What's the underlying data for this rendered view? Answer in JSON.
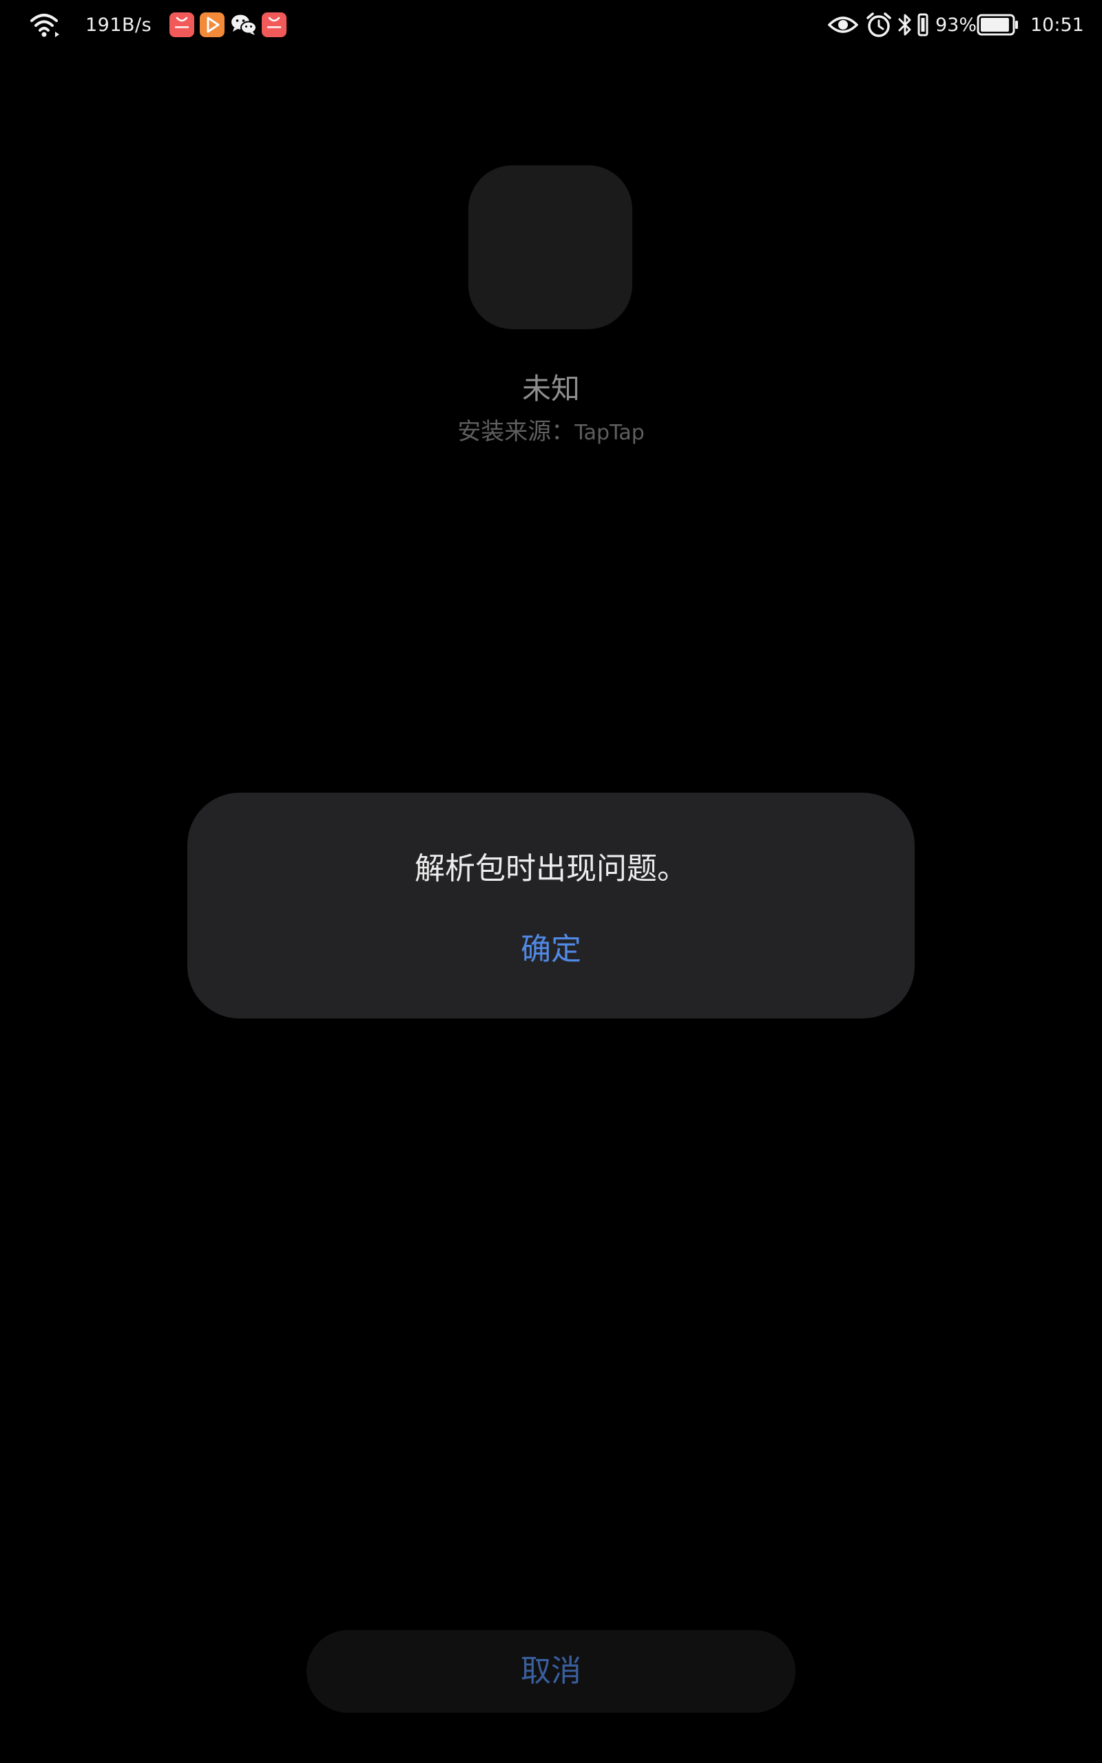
{
  "status_bar": {
    "net_speed": "191B/s",
    "notification_icons": [
      "shopping-bag-icon",
      "video-play-icon",
      "wechat-icon",
      "shopping-bag-icon"
    ],
    "status_icons": [
      "wifi-icon",
      "eye-icon",
      "alarm-icon",
      "bluetooth-icon",
      "vibrate-icon",
      "battery-icon"
    ],
    "battery_percent": "93%",
    "battery_level": 0.93,
    "time": "10:51"
  },
  "app_info": {
    "name": "未知",
    "source_label": "安装来源：",
    "source_value": "TapTap"
  },
  "dialog": {
    "message": "解析包时出现问题。",
    "confirm_label": "确定"
  },
  "cancel_label": "取消",
  "colors": {
    "background": "#000000",
    "dialog_bg": "#232325",
    "accent_blue": "#5189e6",
    "cancel_text": "#3a5f9e",
    "badge_red": "#f25a5a",
    "badge_orange": "#f28a3a"
  }
}
